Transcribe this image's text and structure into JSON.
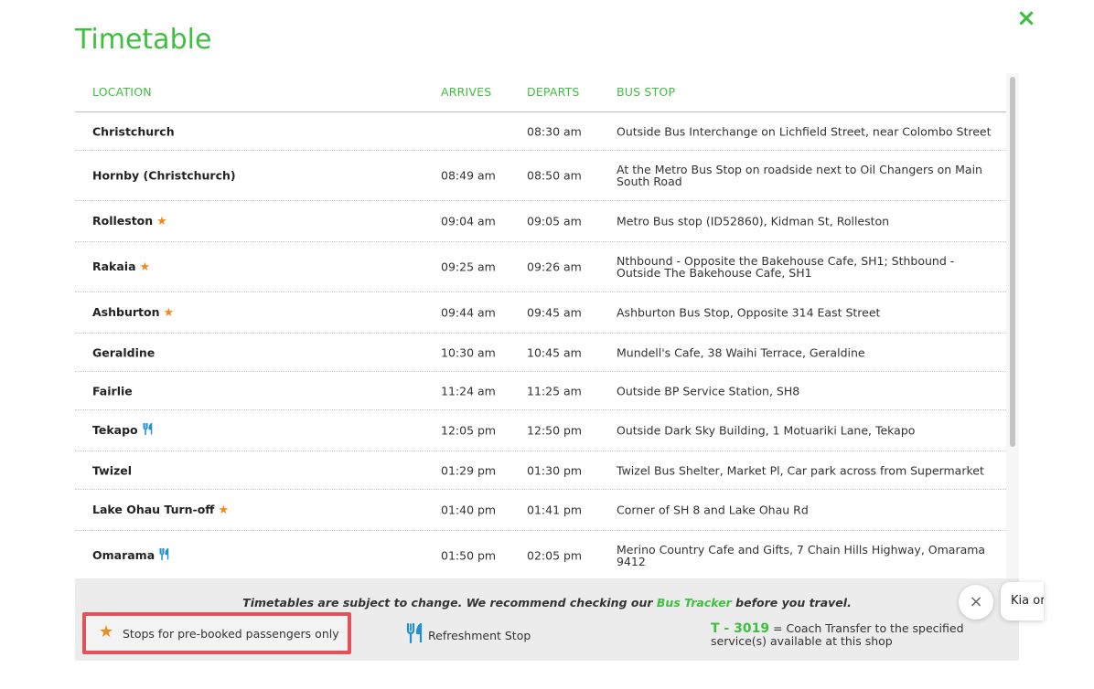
{
  "modal": {
    "title": "Timetable",
    "close_icon": "×"
  },
  "table": {
    "headers": {
      "location": "LOCATION",
      "arrives": "ARRIVES",
      "departs": "DEPARTS",
      "bus_stop": "BUS STOP"
    },
    "rows": [
      {
        "location": "Christchurch",
        "arrives": "",
        "departs": "08:30 am",
        "stop": "Outside Bus Interchange on Lichfield Street, near Colombo Street",
        "icon": ""
      },
      {
        "location": "Hornby (Christchurch)",
        "arrives": "08:49 am",
        "departs": "08:50 am",
        "stop": "At the Metro Bus Stop on roadside next to Oil Changers on Main South Road",
        "icon": ""
      },
      {
        "location": "Rolleston",
        "arrives": "09:04 am",
        "departs": "09:05 am",
        "stop": "Metro Bus stop (ID52860), Kidman St, Rolleston",
        "icon": "star-icon"
      },
      {
        "location": "Rakaia",
        "arrives": "09:25 am",
        "departs": "09:26 am",
        "stop": "Nthbound - Opposite the Bakehouse Cafe, SH1; Sthbound - Outside The Bakehouse Cafe, SH1",
        "icon": "star-icon"
      },
      {
        "location": "Ashburton",
        "arrives": "09:44 am",
        "departs": "09:45 am",
        "stop": "Ashburton Bus Stop, Opposite 314 East Street",
        "icon": "star-icon"
      },
      {
        "location": "Geraldine",
        "arrives": "10:30 am",
        "departs": "10:45 am",
        "stop": "Mundell's Cafe, 38 Waihi Terrace, Geraldine",
        "icon": ""
      },
      {
        "location": "Fairlie",
        "arrives": "11:24 am",
        "departs": "11:25 am",
        "stop": "Outside BP Service Station, SH8",
        "icon": ""
      },
      {
        "location": "Tekapo",
        "arrives": "12:05 pm",
        "departs": "12:50 pm",
        "stop": "Outside Dark Sky Building, 1 Motuariki Lane, Tekapo",
        "icon": "fork-knife-icon"
      },
      {
        "location": "Twizel",
        "arrives": "01:29 pm",
        "departs": "01:30 pm",
        "stop": "Twizel Bus Shelter, Market Pl, Car park across from Supermarket",
        "icon": ""
      },
      {
        "location": "Lake Ohau Turn-off",
        "arrives": "01:40 pm",
        "departs": "01:41 pm",
        "stop": "Corner of SH 8 and Lake Ohau Rd",
        "icon": "star-icon"
      },
      {
        "location": "Omarama",
        "arrives": "01:50 pm",
        "departs": "02:05 pm",
        "stop": "Merino Country Cafe and Gifts, 7 Chain Hills Highway, Omarama 9412",
        "icon": "fork-knife-icon"
      }
    ]
  },
  "footer": {
    "notice_before": "Timetables are subject to change. We recommend checking our ",
    "notice_link": "Bus Tracker",
    "notice_after": " before you travel.",
    "legend_booked": "Stops for pre-booked passengers only",
    "legend_refreshment": "Refreshment Stop",
    "transfer_code": "T - 3019",
    "transfer_text": " = Coach Transfer to the specified service(s) available at this shop"
  },
  "chat": {
    "close_icon": "×",
    "greeting": "Kia ora"
  },
  "colors": {
    "accent": "#3fbf3f",
    "star": "#f08a1c",
    "fork": "#1e90d6",
    "highlight": "#e0535b"
  }
}
